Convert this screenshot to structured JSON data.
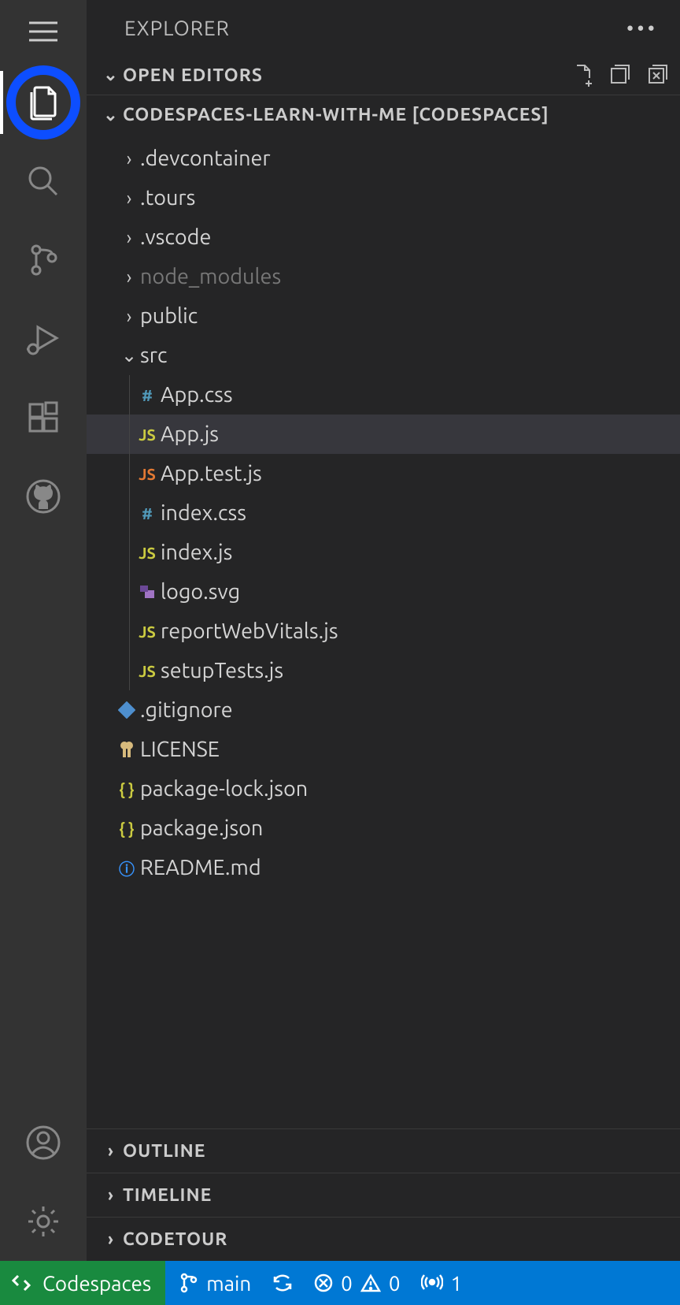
{
  "sidebar": {
    "title": "EXPLORER",
    "sections": {
      "open_editors": {
        "label": "OPEN EDITORS",
        "expanded": true
      },
      "repo": {
        "label": "CODESPACES-LEARN-WITH-ME [CODESPACES]",
        "expanded": true
      },
      "outline": {
        "label": "OUTLINE",
        "expanded": false
      },
      "timeline": {
        "label": "TIMELINE",
        "expanded": false
      },
      "codetour": {
        "label": "CODETOUR",
        "expanded": false
      }
    }
  },
  "tree": {
    "folders": [
      {
        "name": ".devcontainer",
        "expanded": false,
        "muted": false
      },
      {
        "name": ".tours",
        "expanded": false,
        "muted": false
      },
      {
        "name": ".vscode",
        "expanded": false,
        "muted": false
      },
      {
        "name": "node_modules",
        "expanded": false,
        "muted": true
      },
      {
        "name": "public",
        "expanded": false,
        "muted": false
      },
      {
        "name": "src",
        "expanded": true,
        "muted": false
      }
    ],
    "src_files": [
      {
        "name": "App.css",
        "icon": "hash",
        "color": "c-blue",
        "selected": false
      },
      {
        "name": "App.js",
        "icon": "js",
        "color": "c-yellow",
        "selected": true
      },
      {
        "name": "App.test.js",
        "icon": "js",
        "color": "c-orange",
        "selected": false
      },
      {
        "name": "index.css",
        "icon": "hash",
        "color": "c-blue",
        "selected": false
      },
      {
        "name": "index.js",
        "icon": "js",
        "color": "c-yellow",
        "selected": false
      },
      {
        "name": "logo.svg",
        "icon": "svg",
        "color": "c-purple",
        "selected": false
      },
      {
        "name": "reportWebVitals.js",
        "icon": "js",
        "color": "c-yellow",
        "selected": false
      },
      {
        "name": "setupTests.js",
        "icon": "js",
        "color": "c-yellow",
        "selected": false
      }
    ],
    "root_files": [
      {
        "name": ".gitignore",
        "icon": "git",
        "color": "c-git"
      },
      {
        "name": "LICENSE",
        "icon": "key",
        "color": "c-key"
      },
      {
        "name": "package-lock.json",
        "icon": "braces",
        "color": "c-json"
      },
      {
        "name": "package.json",
        "icon": "braces",
        "color": "c-json"
      },
      {
        "name": "README.md",
        "icon": "info",
        "color": "c-info"
      }
    ]
  },
  "status": {
    "codespaces_label": "Codespaces",
    "branch": "main",
    "errors": "0",
    "warnings": "0",
    "ports": "1"
  },
  "icons": {
    "hash": "#",
    "js": "JS",
    "braces": "{ }",
    "info": "ⓘ"
  }
}
